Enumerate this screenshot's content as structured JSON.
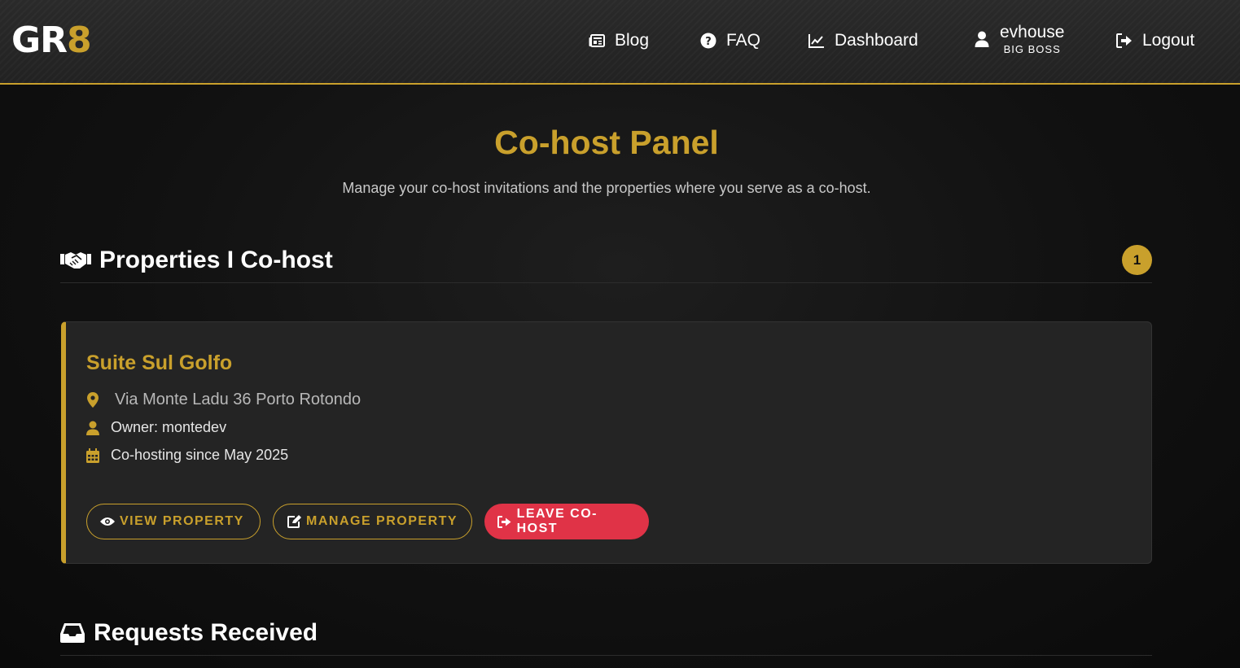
{
  "header": {
    "logo": {
      "left": "GR",
      "right": "8"
    },
    "nav": {
      "blog": "Blog",
      "faq": "FAQ",
      "dashboard": "Dashboard",
      "user_name": "evhouse",
      "user_role": "BIG BOSS",
      "logout": "Logout"
    },
    "icons": [
      "newspaper-icon",
      "question-circle-icon",
      "chart-line-icon",
      "user-icon",
      "sign-out-icon"
    ]
  },
  "main": {
    "title": "Co-host Panel",
    "subtitle": "Manage your co-host invitations and the properties where you serve as a co-host.",
    "properties_section": {
      "title": "Properties I Co-host",
      "count": "1",
      "icon": "handshake-icon"
    },
    "property": {
      "name": "Suite Sul Golfo",
      "address": "Via Monte Ladu 36 Porto Rotondo",
      "owner": "Owner: montedev",
      "since": "Co-hosting since May 2025",
      "buttons": {
        "view": "VIEW PROPERTY",
        "manage": "MANAGE PROPERTY",
        "leave": "LEAVE CO-HOST"
      }
    },
    "requests_section": {
      "title": "Requests Received",
      "icon": "inbox-icon"
    }
  },
  "colors": {
    "accent": "#c9a02c",
    "danger": "#e03347",
    "background": "#111111",
    "card": "#242424"
  }
}
